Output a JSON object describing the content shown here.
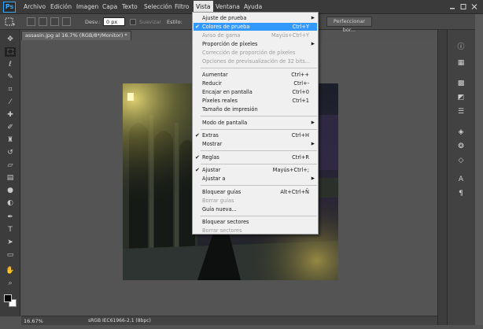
{
  "app": {
    "logo": "Ps",
    "accent": "#31a8ff"
  },
  "menubar": {
    "items": [
      "Archivo",
      "Edición",
      "Imagen",
      "Capa",
      "Texto",
      "Selección",
      "Filtro",
      "Vista",
      "Ventana",
      "Ayuda"
    ],
    "active": "Vista"
  },
  "options": {
    "feather_label": "Desv.:",
    "feather_value": "0 px",
    "antialias_label": "Suavizar",
    "style_label": "Estilo:",
    "refine_button": "Perfeccionar bor..."
  },
  "document": {
    "tab_title": "assasin.jpg al 16.7% (RGB/8*/Monitor) *",
    "close_glyph": "×"
  },
  "status": {
    "zoom": "16.67%",
    "profile": "sRGB IEC61966-2.1 (8bpc)"
  },
  "tools": [
    "move-icon",
    "marquee-icon",
    "lasso-icon",
    "quick-select-icon",
    "crop-icon",
    "eyedropper-icon",
    "healing-icon",
    "brush-icon",
    "clone-stamp-icon",
    "history-brush-icon",
    "eraser-icon",
    "gradient-icon",
    "blur-icon",
    "dodge-icon",
    "pen-icon",
    "type-icon",
    "path-select-icon",
    "shape-icon",
    "hand-icon",
    "zoom-icon"
  ],
  "dock_icons": [
    "info-icon",
    "histogram-icon",
    "swatches-icon",
    "adjustments-icon",
    "styles-icon",
    "layers-icon",
    "channels-icon",
    "paths-icon",
    "character-icon",
    "paragraph-icon"
  ],
  "vista_menu": [
    {
      "label": "Ajuste de prueba",
      "shortcut": "",
      "submenu": true,
      "disabled": false,
      "checked": false,
      "highlight": false
    },
    {
      "label": "Colores de prueba",
      "shortcut": "Ctrl+Y",
      "submenu": false,
      "disabled": false,
      "checked": true,
      "highlight": true
    },
    {
      "label": "Aviso de gama",
      "shortcut": "Mayús+Ctrl+Y",
      "submenu": false,
      "disabled": true,
      "checked": false,
      "highlight": false
    },
    {
      "label": "Proporción de píxeles",
      "shortcut": "",
      "submenu": true,
      "disabled": false,
      "checked": false,
      "highlight": false
    },
    {
      "label": "Corrección de proporción de píxeles",
      "shortcut": "",
      "submenu": false,
      "disabled": true,
      "checked": false,
      "highlight": false
    },
    {
      "label": "Opciones de previsualización de 32 bits...",
      "shortcut": "",
      "submenu": false,
      "disabled": true,
      "checked": false,
      "highlight": false
    },
    {
      "label": "Aumentar",
      "shortcut": "Ctrl++",
      "submenu": false,
      "disabled": false,
      "checked": false,
      "highlight": false
    },
    {
      "label": "Reducir",
      "shortcut": "Ctrl+-",
      "submenu": false,
      "disabled": false,
      "checked": false,
      "highlight": false
    },
    {
      "label": "Encajar en pantalla",
      "shortcut": "Ctrl+0",
      "submenu": false,
      "disabled": false,
      "checked": false,
      "highlight": false
    },
    {
      "label": "Píxeles reales",
      "shortcut": "Ctrl+1",
      "submenu": false,
      "disabled": false,
      "checked": false,
      "highlight": false
    },
    {
      "label": "Tamaño de impresión",
      "shortcut": "",
      "submenu": false,
      "disabled": false,
      "checked": false,
      "highlight": false
    },
    {
      "label": "Modo de pantalla",
      "shortcut": "",
      "submenu": true,
      "disabled": false,
      "checked": false,
      "highlight": false
    },
    {
      "label": "Extras",
      "shortcut": "Ctrl+H",
      "submenu": false,
      "disabled": false,
      "checked": true,
      "highlight": false
    },
    {
      "label": "Mostrar",
      "shortcut": "",
      "submenu": true,
      "disabled": false,
      "checked": false,
      "highlight": false
    },
    {
      "label": "Reglas",
      "shortcut": "Ctrl+R",
      "submenu": false,
      "disabled": false,
      "checked": true,
      "highlight": false
    },
    {
      "label": "Ajustar",
      "shortcut": "Mayús+Ctrl+;",
      "submenu": false,
      "disabled": false,
      "checked": true,
      "highlight": false
    },
    {
      "label": "Ajustar a",
      "shortcut": "",
      "submenu": true,
      "disabled": false,
      "checked": false,
      "highlight": false
    },
    {
      "label": "Bloquear guías",
      "shortcut": "Alt+Ctrl+Ñ",
      "submenu": false,
      "disabled": false,
      "checked": false,
      "highlight": false
    },
    {
      "label": "Borrar guías",
      "shortcut": "",
      "submenu": false,
      "disabled": true,
      "checked": false,
      "highlight": false
    },
    {
      "label": "Guía nueva...",
      "shortcut": "",
      "submenu": false,
      "disabled": false,
      "checked": false,
      "highlight": false
    },
    {
      "label": "Bloquear sectores",
      "shortcut": "",
      "submenu": false,
      "disabled": false,
      "checked": false,
      "highlight": false
    },
    {
      "label": "Borrar sectores",
      "shortcut": "",
      "submenu": false,
      "disabled": true,
      "checked": false,
      "highlight": false
    }
  ]
}
